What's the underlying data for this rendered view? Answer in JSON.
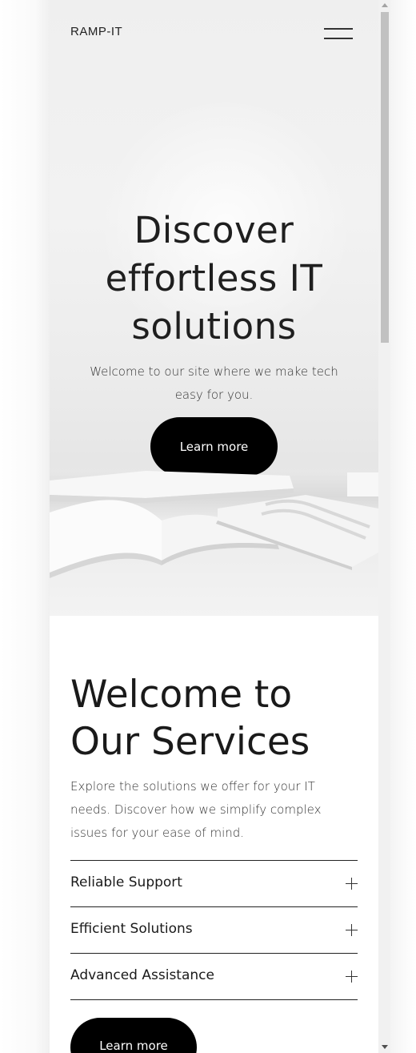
{
  "header": {
    "brand": "RAMP-IT",
    "menu_icon": "hamburger-icon"
  },
  "hero": {
    "title_line1": "Discover",
    "title_line2": "effortless IT",
    "title_line3": "solutions",
    "subtitle": "Welcome to our site where we make tech easy for you.",
    "cta_label": "Learn more"
  },
  "services": {
    "title_line1": "Welcome to",
    "title_line2": "Our Services",
    "description": "Explore the solutions we offer for your IT needs. Discover how we simplify complex issues for your ease of mind.",
    "items": [
      {
        "label": "Reliable Support",
        "icon": "plus-icon"
      },
      {
        "label": "Efficient Solutions",
        "icon": "plus-icon"
      },
      {
        "label": "Advanced Assistance",
        "icon": "plus-icon"
      }
    ],
    "cta_label": "Learn more"
  },
  "colors": {
    "text": "#1a1a1a",
    "button_bg": "#000000",
    "button_text": "#ffffff",
    "hero_bg": "#efefef"
  }
}
